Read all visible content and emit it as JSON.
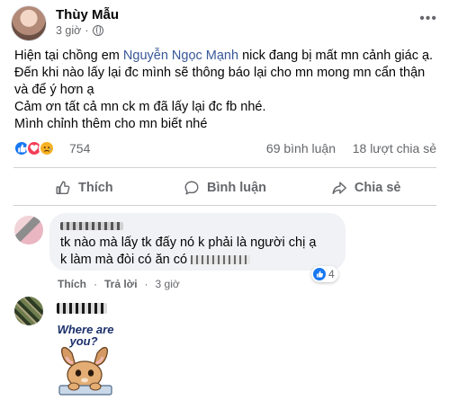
{
  "post": {
    "author": "Thùy Mẫu",
    "time": "3 giờ",
    "privacy_icon": "globe-icon",
    "more_icon": "more-horizontal-icon",
    "text_line1_before": "Hiện tại chồng em ",
    "mention": "Nguyễn Ngọc Mạnh",
    "text_line1_after": "  nick đang bị mất mn cảnh giác ạ. Đến khi nào lấy lại đc mình sẽ thông báo lại cho mn mong mn cẩn thận và để ý hơn ạ",
    "text_line2": "Cảm ơn tất cả mn ck m đã lấy lại đc fb nhé.",
    "text_line3": "Mình chỉnh thêm cho mn biết nhé"
  },
  "stats": {
    "reactions": "754",
    "comments": "69 bình luận",
    "shares": "18 lượt chia sẻ",
    "reaction_types": [
      "like",
      "love",
      "sad"
    ]
  },
  "actions": {
    "like": "Thích",
    "comment": "Bình luận",
    "share": "Chia sẻ"
  },
  "comment1": {
    "text_line1": "tk nào mà lấy tk đấy nó k phải là người chị ạ",
    "text_line2": "k làm mà đòi có ăn có ",
    "reaction_count": "4",
    "like_action": "Thích",
    "reply_action": "Trả lời",
    "time": "3 giờ",
    "separator": "·"
  },
  "comment2": {
    "sticker_text_line1": "Where are",
    "sticker_text_line2": "you?"
  },
  "colors": {
    "like_blue": "#1877f2",
    "love_red": "#f33e58",
    "sad_yellow": "#f7b125",
    "mention": "#385898",
    "muted": "#65676b"
  }
}
